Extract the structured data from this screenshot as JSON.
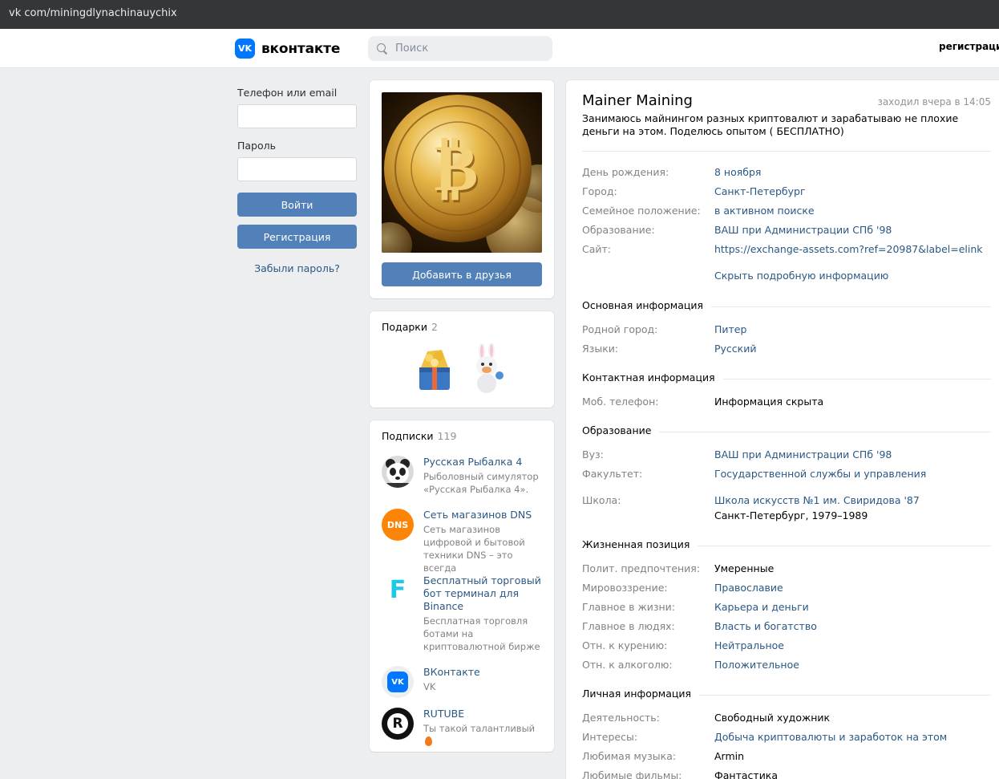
{
  "browser": {
    "url": "vk com/miningdlynachinauychix"
  },
  "header": {
    "logo_mark": "VK",
    "logo_text": "вконтакте",
    "search_placeholder": "Поиск",
    "register_link": "регистрация"
  },
  "login": {
    "phone_label": "Телефон или email",
    "password_label": "Пароль",
    "login_button": "Войти",
    "register_button": "Регистрация",
    "forgot_link": "Забыли пароль?"
  },
  "profile": {
    "add_friend_button": "Добавить в друзья",
    "name": "Mainer Maining",
    "last_seen": "заходил вчера в 14:05",
    "status": "Занимаюсь майнингом разных криптовалют и зарабатываю не плохие деньги на этом. Поделюсь опытом ( БЕСПЛАТНО)",
    "short_info": [
      {
        "label": "День рождения:",
        "value": "8 ноября",
        "link": true
      },
      {
        "label": "Город:",
        "value": "Санкт-Петербург",
        "link": true
      },
      {
        "label": "Семейное положение:",
        "value": "в активном поиске",
        "link": true
      },
      {
        "label": "Образование:",
        "value": "ВАШ при Администрации СПб '98",
        "link": true
      },
      {
        "label": "Сайт:",
        "value": "https://exchange-assets.com?ref=20987&label=elink",
        "link": true
      }
    ],
    "hide_details": "Скрыть подробную информацию",
    "sections": {
      "basic": "Основная информация",
      "contact": "Контактная информация",
      "education": "Образование",
      "life_position": "Жизненная позиция",
      "personal": "Личная информация"
    },
    "basic_info": [
      {
        "label": "Родной город:",
        "value": "Питер"
      },
      {
        "label": "Языки:",
        "value": "Русский"
      }
    ],
    "contact_info": [
      {
        "label": "Моб. телефон:",
        "value": "Информация скрыта"
      }
    ],
    "education_info": [
      {
        "label": "Вуз:",
        "value": "ВАШ при Администрации СПб '98"
      },
      {
        "label": "Факультет:",
        "value": "Государственной службы и управления"
      },
      {
        "label": "Школа:",
        "value": "Школа искусств №1 им. Свиридова '87",
        "value2": "Санкт-Петербург, 1979–1989"
      }
    ],
    "life_info": [
      {
        "label": "Полит. предпочтения:",
        "value": "Умеренные"
      },
      {
        "label": "Мировоззрение:",
        "value": "Православие"
      },
      {
        "label": "Главное в жизни:",
        "value": "Карьера и деньги"
      },
      {
        "label": "Главное в людях:",
        "value": "Власть и богатство"
      },
      {
        "label": "Отн. к курению:",
        "value": "Нейтральное"
      },
      {
        "label": "Отн. к алкоголю:",
        "value": "Положительное"
      }
    ],
    "personal_info": [
      {
        "label": "Деятельность:",
        "value": "Свободный художник"
      },
      {
        "label": "Интересы:",
        "value": "Добыча криптовалюты и заработок на этом"
      },
      {
        "label": "Любимая музыка:",
        "value": "Armin"
      },
      {
        "label": "Любимые фильмы:",
        "value": "Фантастика"
      }
    ]
  },
  "gifts": {
    "title": "Подарки",
    "count": "2"
  },
  "subscriptions": {
    "title": "Подписки",
    "count": "119",
    "items": [
      {
        "name": "Русская Рыбалка 4",
        "desc": "Рыболовный симулятор «Русская Рыбалка 4».",
        "icon": "panda-avatar-icon"
      },
      {
        "name": "Сеть магазинов DNS",
        "desc": "Сеть магазинов цифровой и бытовой техники DNS – это всегда",
        "icon": "dns-logo-icon",
        "badge": "DNS"
      },
      {
        "name": "Бесплатный торговый бот терминал для Binance",
        "desc": "Бесплатная торговля ботами на криптовалютной бирже",
        "icon": "f-logo-icon",
        "badge": "F"
      },
      {
        "name": "ВКонтакте",
        "desc": "VK",
        "icon": "vk-logo-icon",
        "badge": "VK"
      },
      {
        "name": "RUTUBE",
        "desc": "Ты такой талантливый",
        "icon": "rutube-logo-icon",
        "badge": "R"
      }
    ]
  },
  "colors": {
    "accent": "#5181b8",
    "link": "#2a5885",
    "vk_blue": "#0077ff",
    "dns_orange": "#fc8507",
    "binance_f": "#1ec8e6"
  }
}
